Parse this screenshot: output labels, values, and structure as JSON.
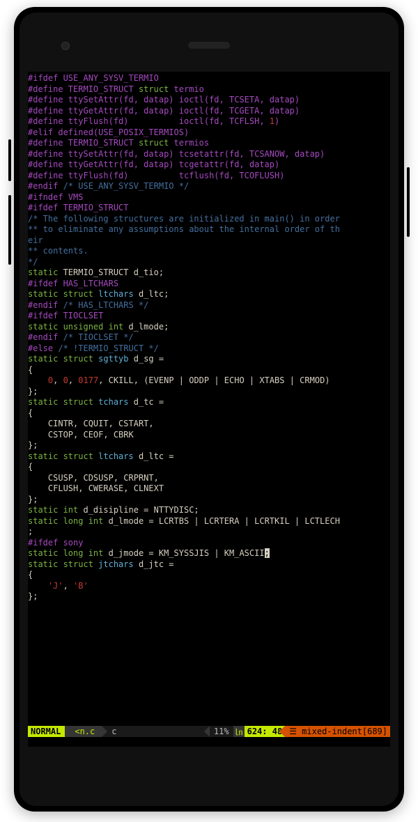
{
  "status": {
    "mode": " NORMAL ",
    "file": "<n.c",
    "filetype": "c",
    "percent": "11%",
    "ln_label": "㏑",
    "position": " 624: 48 ",
    "warning": "☰ mixed-indent[689]"
  },
  "lines": [
    [
      [
        "c-pp",
        "#ifdef USE_ANY_SYSV_TERMIO"
      ]
    ],
    [
      [
        "c-pp",
        "#define TERMIO_STRUCT "
      ],
      [
        "c-kw",
        "struct"
      ],
      [
        "c-pp",
        " termio"
      ]
    ],
    [
      [
        "c-pp",
        "#define ttySetAttr(fd, datap) ioctl(fd, TCSETA, datap)"
      ]
    ],
    [
      [
        "c-pp",
        "#define ttyGetAttr(fd, datap) ioctl(fd, TCGETA, datap)"
      ]
    ],
    [
      [
        "c-pp",
        "#define ttyFlush(fd)          ioctl(fd, TCFLSH, "
      ],
      [
        "c-num",
        "1"
      ],
      [
        "c-pp",
        ")"
      ]
    ],
    [
      [
        "c-pp",
        "#elif defined(USE_POSIX_TERMIOS)"
      ]
    ],
    [
      [
        "c-pp",
        "#define TERMIO_STRUCT "
      ],
      [
        "c-kw",
        "struct"
      ],
      [
        "c-pp",
        " termios"
      ]
    ],
    [
      [
        "c-pp",
        "#define ttySetAttr(fd, datap) tcsetattr(fd, TCSANOW, datap)"
      ]
    ],
    [
      [
        "c-pp",
        "#define ttyGetAttr(fd, datap) tcgetattr(fd, datap)"
      ]
    ],
    [
      [
        "c-pp",
        "#define ttyFlush(fd)          tcflush(fd, TCOFLUSH)"
      ]
    ],
    [
      [
        "c-pp",
        "#endif "
      ],
      [
        "c-com",
        "/* USE_ANY_SYSV_TERMIO */"
      ]
    ],
    [
      [
        "c-txt",
        ""
      ]
    ],
    [
      [
        "c-pp",
        "#ifndef VMS"
      ]
    ],
    [
      [
        "c-pp",
        "#ifdef TERMIO_STRUCT"
      ]
    ],
    [
      [
        "c-com",
        "/* The following structures are initialized in main() in order"
      ]
    ],
    [
      [
        "c-com",
        "** to eliminate any assumptions about the internal order of th"
      ]
    ],
    [
      [
        "c-com",
        "eir"
      ]
    ],
    [
      [
        "c-com",
        "** contents."
      ]
    ],
    [
      [
        "c-com",
        "*/"
      ]
    ],
    [
      [
        "c-kw",
        "static"
      ],
      [
        "c-txt",
        " TERMIO_STRUCT d_tio;"
      ]
    ],
    [
      [
        "c-txt",
        ""
      ]
    ],
    [
      [
        "c-pp",
        "#ifdef HAS_LTCHARS"
      ]
    ],
    [
      [
        "c-kw",
        "static struct"
      ],
      [
        "c-txt",
        " "
      ],
      [
        "c-type",
        "ltchars"
      ],
      [
        "c-txt",
        " d_ltc;"
      ]
    ],
    [
      [
        "c-pp",
        "#endif "
      ],
      [
        "c-com",
        "/* HAS_LTCHARS */"
      ]
    ],
    [
      [
        "c-txt",
        ""
      ]
    ],
    [
      [
        "c-pp",
        "#ifdef TIOCLSET"
      ]
    ],
    [
      [
        "c-kw",
        "static unsigned int"
      ],
      [
        "c-txt",
        " d_lmode;"
      ]
    ],
    [
      [
        "c-pp",
        "#endif "
      ],
      [
        "c-com",
        "/* TIOCLSET */"
      ]
    ],
    [
      [
        "c-txt",
        ""
      ]
    ],
    [
      [
        "c-pp",
        "#else "
      ],
      [
        "c-com",
        "/* !TERMIO_STRUCT */"
      ]
    ],
    [
      [
        "c-kw",
        "static struct"
      ],
      [
        "c-txt",
        " "
      ],
      [
        "c-type",
        "sgttyb"
      ],
      [
        "c-txt",
        " d_sg ="
      ]
    ],
    [
      [
        "c-txt",
        "{"
      ]
    ],
    [
      [
        "c-txt",
        "    "
      ],
      [
        "c-num",
        "0"
      ],
      [
        "c-txt",
        ", "
      ],
      [
        "c-num",
        "0"
      ],
      [
        "c-txt",
        ", "
      ],
      [
        "c-num",
        "0177"
      ],
      [
        "c-txt",
        ", CKILL, (EVENP | ODDP | ECHO | XTABS | CRMOD)"
      ]
    ],
    [
      [
        "c-txt",
        "};"
      ]
    ],
    [
      [
        "c-kw",
        "static struct"
      ],
      [
        "c-txt",
        " "
      ],
      [
        "c-type",
        "tchars"
      ],
      [
        "c-txt",
        " d_tc ="
      ]
    ],
    [
      [
        "c-txt",
        "{"
      ]
    ],
    [
      [
        "c-txt",
        "    CINTR, CQUIT, CSTART,"
      ]
    ],
    [
      [
        "c-txt",
        "    CSTOP, CEOF, CBRK"
      ]
    ],
    [
      [
        "c-txt",
        "};"
      ]
    ],
    [
      [
        "c-kw",
        "static struct"
      ],
      [
        "c-txt",
        " "
      ],
      [
        "c-type",
        "ltchars"
      ],
      [
        "c-txt",
        " d_ltc ="
      ]
    ],
    [
      [
        "c-txt",
        "{"
      ]
    ],
    [
      [
        "c-txt",
        "    CSUSP, CDSUSP, CRPRNT,"
      ]
    ],
    [
      [
        "c-txt",
        "    CFLUSH, CWERASE, CLNEXT"
      ]
    ],
    [
      [
        "c-txt",
        "};"
      ]
    ],
    [
      [
        "c-kw",
        "static int"
      ],
      [
        "c-txt",
        " d_disipline = NTTYDISC;"
      ]
    ],
    [
      [
        "c-kw",
        "static long int"
      ],
      [
        "c-txt",
        " d_lmode = LCRTBS | LCRTERA | LCRTKIL | LCTLECH"
      ]
    ],
    [
      [
        "c-txt",
        ";"
      ]
    ],
    [
      [
        "c-pp",
        "#ifdef sony"
      ]
    ],
    [
      [
        "c-kw",
        "static long int"
      ],
      [
        "c-txt",
        " d_jmode = KM_SYSSJIS | KM_ASCII"
      ],
      [
        "cursor",
        ";"
      ]
    ],
    [
      [
        "c-kw",
        "static struct"
      ],
      [
        "c-txt",
        " "
      ],
      [
        "c-type",
        "jtchars"
      ],
      [
        "c-txt",
        " d_jtc ="
      ]
    ],
    [
      [
        "c-txt",
        "{"
      ]
    ],
    [
      [
        "c-txt",
        "    "
      ],
      [
        "c-num",
        "'J'"
      ],
      [
        "c-txt",
        ", "
      ],
      [
        "c-num",
        "'B'"
      ]
    ],
    [
      [
        "c-txt",
        "};"
      ]
    ]
  ]
}
